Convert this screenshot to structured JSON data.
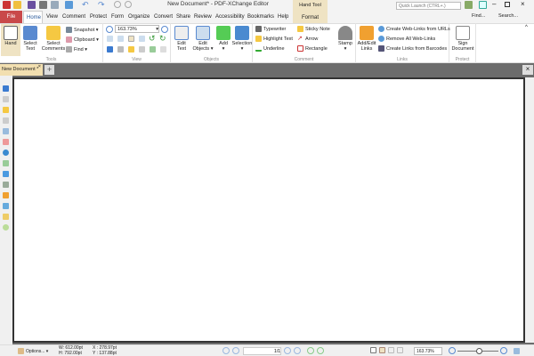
{
  "window": {
    "title": "New Document* - PDF-XChange Editor",
    "quick_launch_placeholder": "Quick Launch (CTRL+.)",
    "find": "Find...",
    "search": "Search..."
  },
  "menu": [
    "File",
    "Home",
    "View",
    "Comment",
    "Protect",
    "Form",
    "Organize",
    "Convert",
    "Share",
    "Review",
    "Accessibility",
    "Bookmarks",
    "Help"
  ],
  "context": {
    "group": "Hand Tool",
    "tab": "Format"
  },
  "ribbon": {
    "tools": {
      "label": "Tools",
      "hand": "Hand",
      "select_text": "Select Text",
      "select_comments": "Select Comments",
      "snapshot": "Snapshot",
      "clipboard": "Clipboard",
      "find": "Find"
    },
    "view": {
      "label": "View",
      "zoom": "163.73%"
    },
    "objects": {
      "label": "Objects",
      "edit_text": "Edit Text",
      "edit_objects": "Edit Objects",
      "add": "Add",
      "selection": "Selection"
    },
    "comment": {
      "label": "Comment",
      "typewriter": "Typewriter",
      "highlight": "Highlight Text",
      "underline": "Underline",
      "sticky": "Sticky Note",
      "arrow": "Arrow",
      "rectangle": "Rectangle",
      "stamp": "Stamp"
    },
    "links": {
      "label": "Links",
      "add_edit": "Add/Edit Links",
      "create": "Create Web-Links from URLs",
      "remove": "Remove All Web-Links",
      "barcodes": "Create Links from Barcodes"
    },
    "protect": {
      "label": "Protect",
      "sign": "Sign Document"
    }
  },
  "doc_tab": "New Document *",
  "status": {
    "options": "Options...",
    "w": "W: 612.00pt",
    "h": "H: 792.00pt",
    "x": "X : 278.97pt",
    "y": "Y : 137.88pt",
    "page": "1/1",
    "zoom": "163.73%"
  },
  "colors": {
    "file": "#c9494a",
    "context": "#efe3c3",
    "doc_tab": "#f2dfb0"
  }
}
